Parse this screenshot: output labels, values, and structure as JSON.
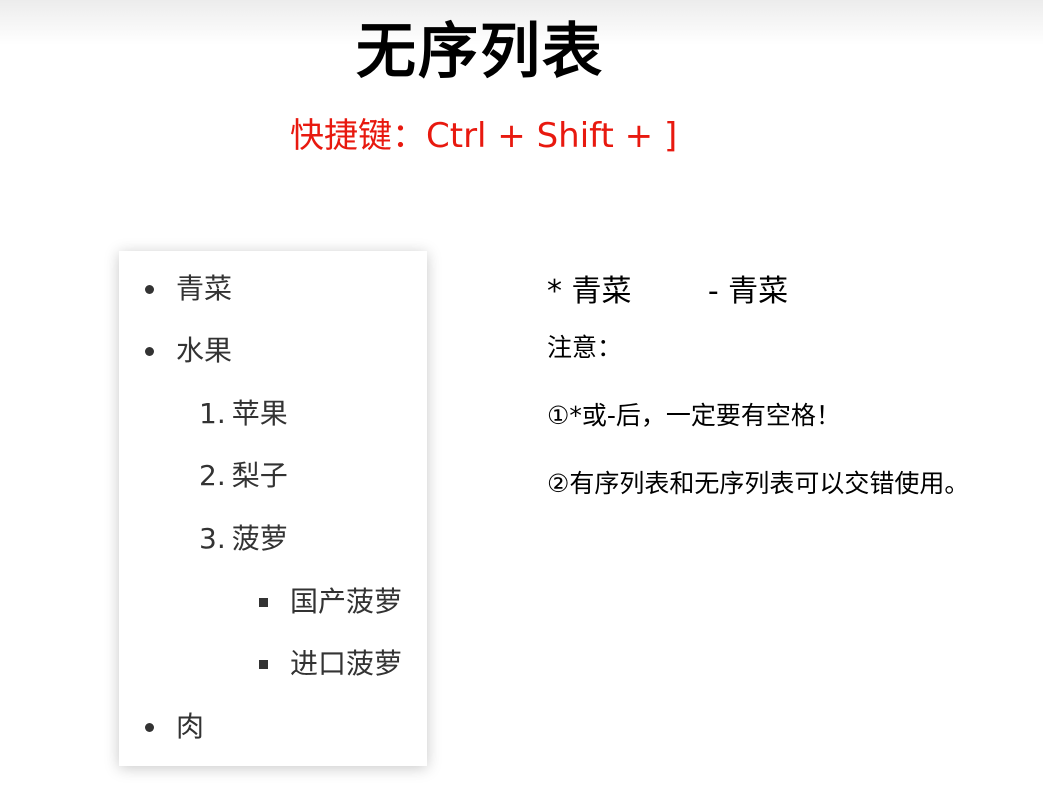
{
  "title": "无序列表",
  "shortcut": "快捷键：Ctrl + Shift + ]",
  "list": {
    "item1": "青菜",
    "item2": "水果",
    "sub1_num": "1.",
    "sub1": "苹果",
    "sub2_num": "2.",
    "sub2": "梨子",
    "sub3_num": "3.",
    "sub3": "菠萝",
    "subsub1": "国产菠萝",
    "subsub2": "进口菠萝",
    "item3": "肉"
  },
  "notes": {
    "syntax_examples": "* 青菜        - 青菜",
    "label": "注意：",
    "line1": "①*或-后，一定要有空格！",
    "line2": "②有序列表和无序列表可以交错使用。"
  }
}
